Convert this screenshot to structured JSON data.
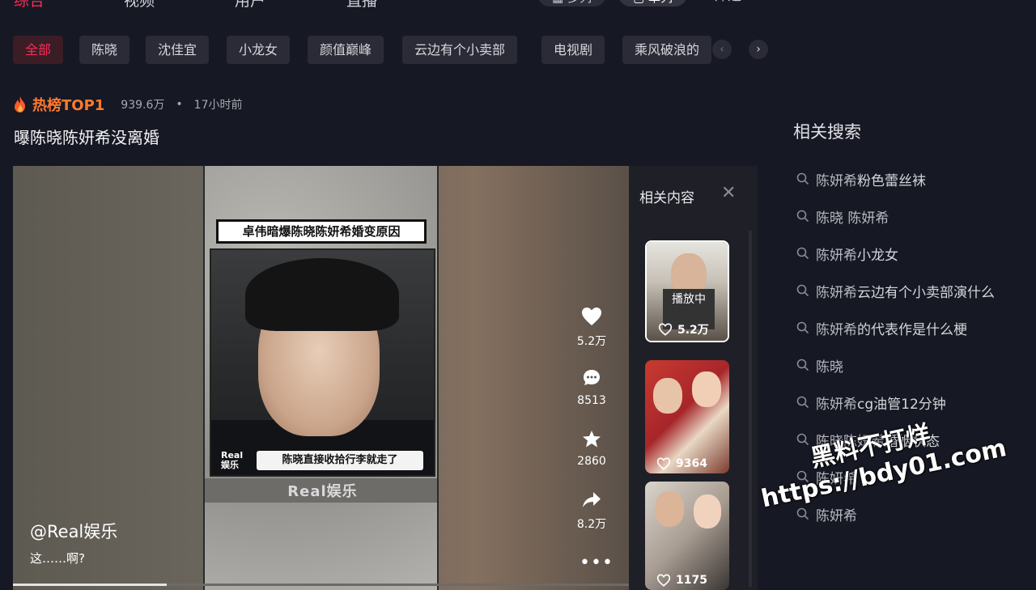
{
  "top_tabs": [
    {
      "label": "综合",
      "active": true
    },
    {
      "label": "视频"
    },
    {
      "label": "用户"
    },
    {
      "label": "直播"
    }
  ],
  "view": {
    "multi_label": "多列",
    "single_label": "单列",
    "filter_label": "筛选"
  },
  "chips": [
    "全部",
    "陈晓",
    "沈佳宜",
    "小龙女",
    "颜值巅峰",
    "云边有个小卖部",
    "电视剧",
    "乘风破浪的"
  ],
  "hot": {
    "label": "热榜TOP1",
    "count": "939.6万",
    "separator": "•",
    "time": "17小时前"
  },
  "video": {
    "title": "曝陈晓陈妍希没离婚",
    "banner": "卓伟暗爆陈晓陈妍希婚变原因",
    "subtitle": "陈晓直接收拾行李就走了",
    "corner_logo": "Real\n娱乐",
    "watermark": "Real娱乐",
    "author": "@Real娱乐",
    "desc": "这……啊?",
    "progress": 0.25,
    "likes": "5.2万",
    "comments": "8513",
    "favorites": "2860",
    "shares": "8.2万"
  },
  "related_content": {
    "title": "相关内容",
    "close": "✕",
    "items": [
      {
        "likes": "5.2万",
        "status": "播放中"
      },
      {
        "likes": "9364"
      },
      {
        "likes": "1175"
      }
    ]
  },
  "related_search": {
    "title": "相关搜索",
    "items": [
      {
        "prefix": "陈妍希",
        "rest": "粉色蕾丝袜"
      },
      {
        "prefix": "陈晓 陈妍希",
        "rest": ""
      },
      {
        "prefix": "陈妍希",
        "rest": "小龙女"
      },
      {
        "prefix": "陈妍希",
        "rest": "云边有个小卖部演什么"
      },
      {
        "prefix": "陈妍希",
        "rest": "的代表作是什么梗"
      },
      {
        "prefix": "陈晓",
        "rest": ""
      },
      {
        "prefix": "陈妍希",
        "rest": "cg油管12分钟"
      },
      {
        "prefix": "陈晓陈妍希",
        "rest": "婚姻状态"
      },
      {
        "prefix": "陈妍希",
        "rest": ""
      },
      {
        "prefix": "陈妍希",
        "rest": ""
      }
    ]
  },
  "site_watermark": {
    "line1": "黑料不打烊",
    "line2": "https://bdy01.com"
  },
  "colors": {
    "accent": "#fe2c55",
    "hot": "#ff7a2f",
    "bg": "#161823"
  }
}
